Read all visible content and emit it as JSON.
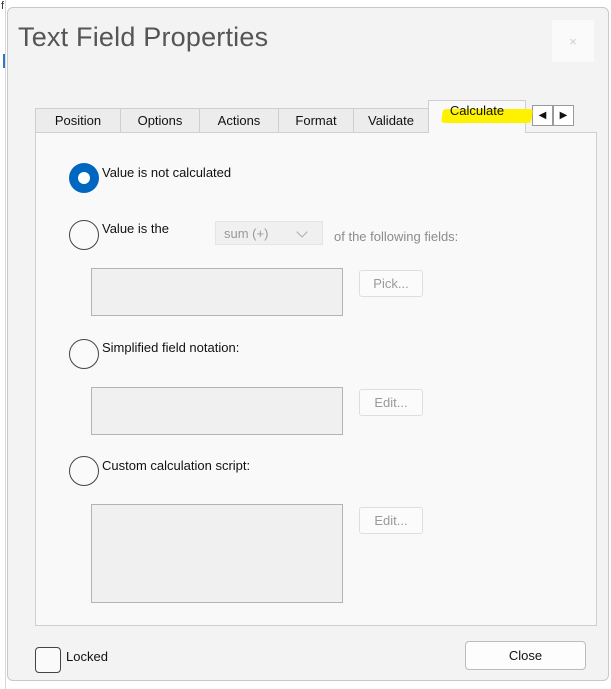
{
  "background_edge": {
    "text": "f"
  },
  "dialog": {
    "title": "Text Field Properties",
    "close_glyph": "×"
  },
  "tabs": [
    {
      "label": "Position"
    },
    {
      "label": "Options"
    },
    {
      "label": "Actions"
    },
    {
      "label": "Format"
    },
    {
      "label": "Validate"
    },
    {
      "label": "Calculate",
      "active": true
    }
  ],
  "tab_scroll": {
    "left_glyph": "◀",
    "right_glyph": "▶"
  },
  "calculate": {
    "option_not_calculated": {
      "label": "Value is not calculated",
      "selected": true
    },
    "option_value_is_the": {
      "label": "Value is the",
      "selected": false,
      "operation_value": "sum (+)",
      "suffix": "of the following fields:",
      "pick_button": "Pick..."
    },
    "option_simplified": {
      "label": "Simplified field notation:",
      "selected": false,
      "edit_button": "Edit..."
    },
    "option_custom": {
      "label": "Custom calculation script:",
      "selected": false,
      "edit_button": "Edit..."
    }
  },
  "footer": {
    "locked_label": "Locked",
    "locked_checked": false,
    "close_button": "Close"
  },
  "colors": {
    "accent": "#0067c0",
    "highlight": "#fff200",
    "dialog_bg": "#f3f3f3",
    "panel_bg": "#f9f9f9"
  },
  "icons": [
    "close-icon",
    "scroll-left-icon",
    "scroll-right-icon",
    "chevron-down-icon"
  ]
}
